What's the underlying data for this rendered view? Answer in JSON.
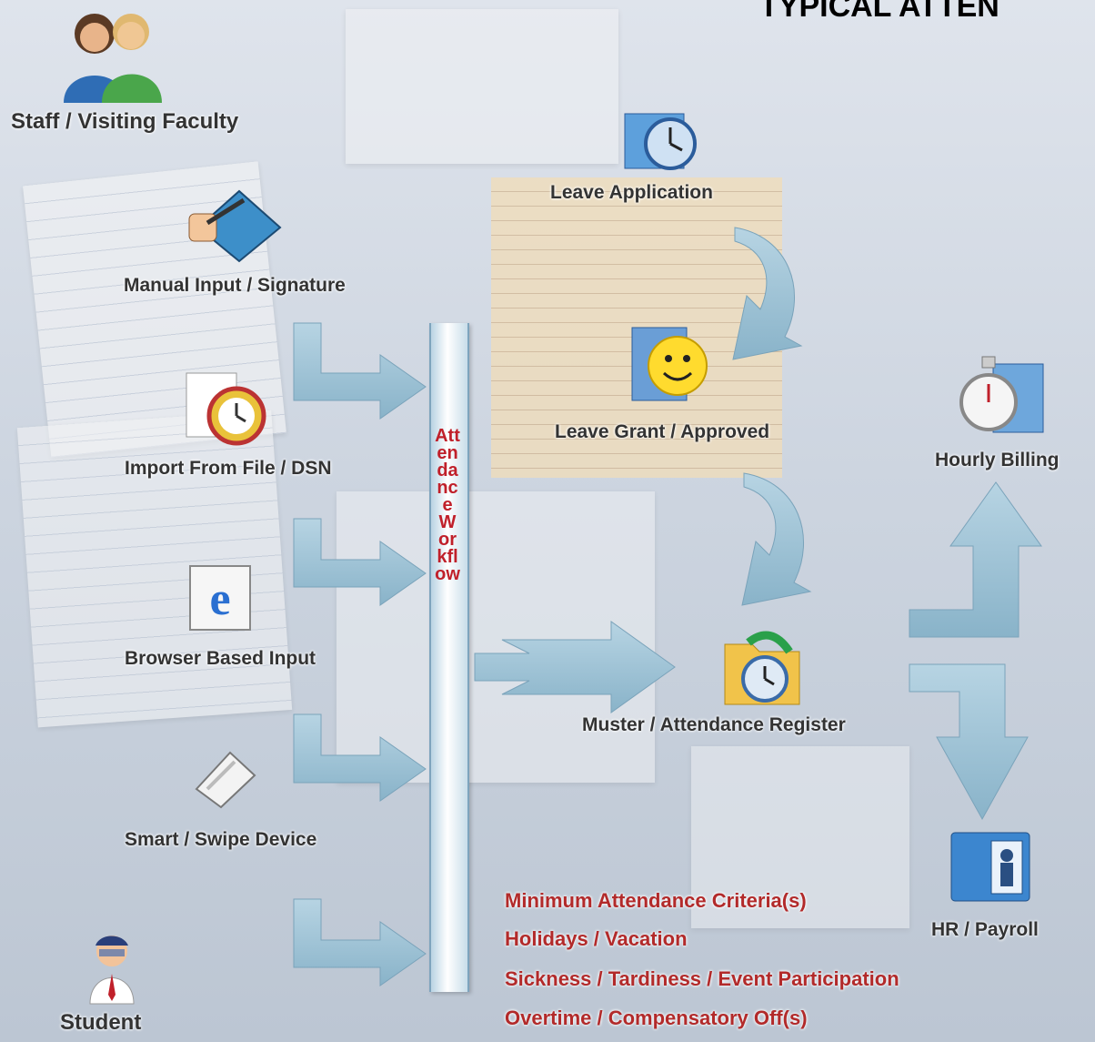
{
  "title": "TYPICAL ATTEN",
  "inputs": {
    "staff": "Staff / Visiting Faculty",
    "manual": "Manual Input / Signature",
    "import": "Import From File / DSN",
    "browser": "Browser Based Input",
    "smart": "Smart / Swipe Device",
    "student": "Student"
  },
  "workflow": {
    "label": "Attendance Workflow"
  },
  "leave": {
    "application": "Leave Application",
    "grant": "Leave Grant / Approved"
  },
  "muster": "Muster / Attendance Register",
  "outputs": {
    "hourly": "Hourly Billing",
    "hr": "HR / Payroll"
  },
  "criteria": [
    "Minimum Attendance Criteria(s)",
    "Holidays / Vacation",
    "Sickness / Tardiness / Event Participation",
    "Overtime / Compensatory Off(s)"
  ],
  "colors": {
    "arrow": "#9ec3d6",
    "criteria": "#b22a2a",
    "workflow_text": "#c0202a"
  },
  "icons": [
    "users-icon",
    "pen-signature-icon",
    "import-clock-icon",
    "browser-ie-icon",
    "swipe-device-icon",
    "student-icon",
    "leave-clock-icon",
    "smiley-folder-icon",
    "muster-folder-icon",
    "stopwatch-icon",
    "payroll-folder-icon"
  ]
}
